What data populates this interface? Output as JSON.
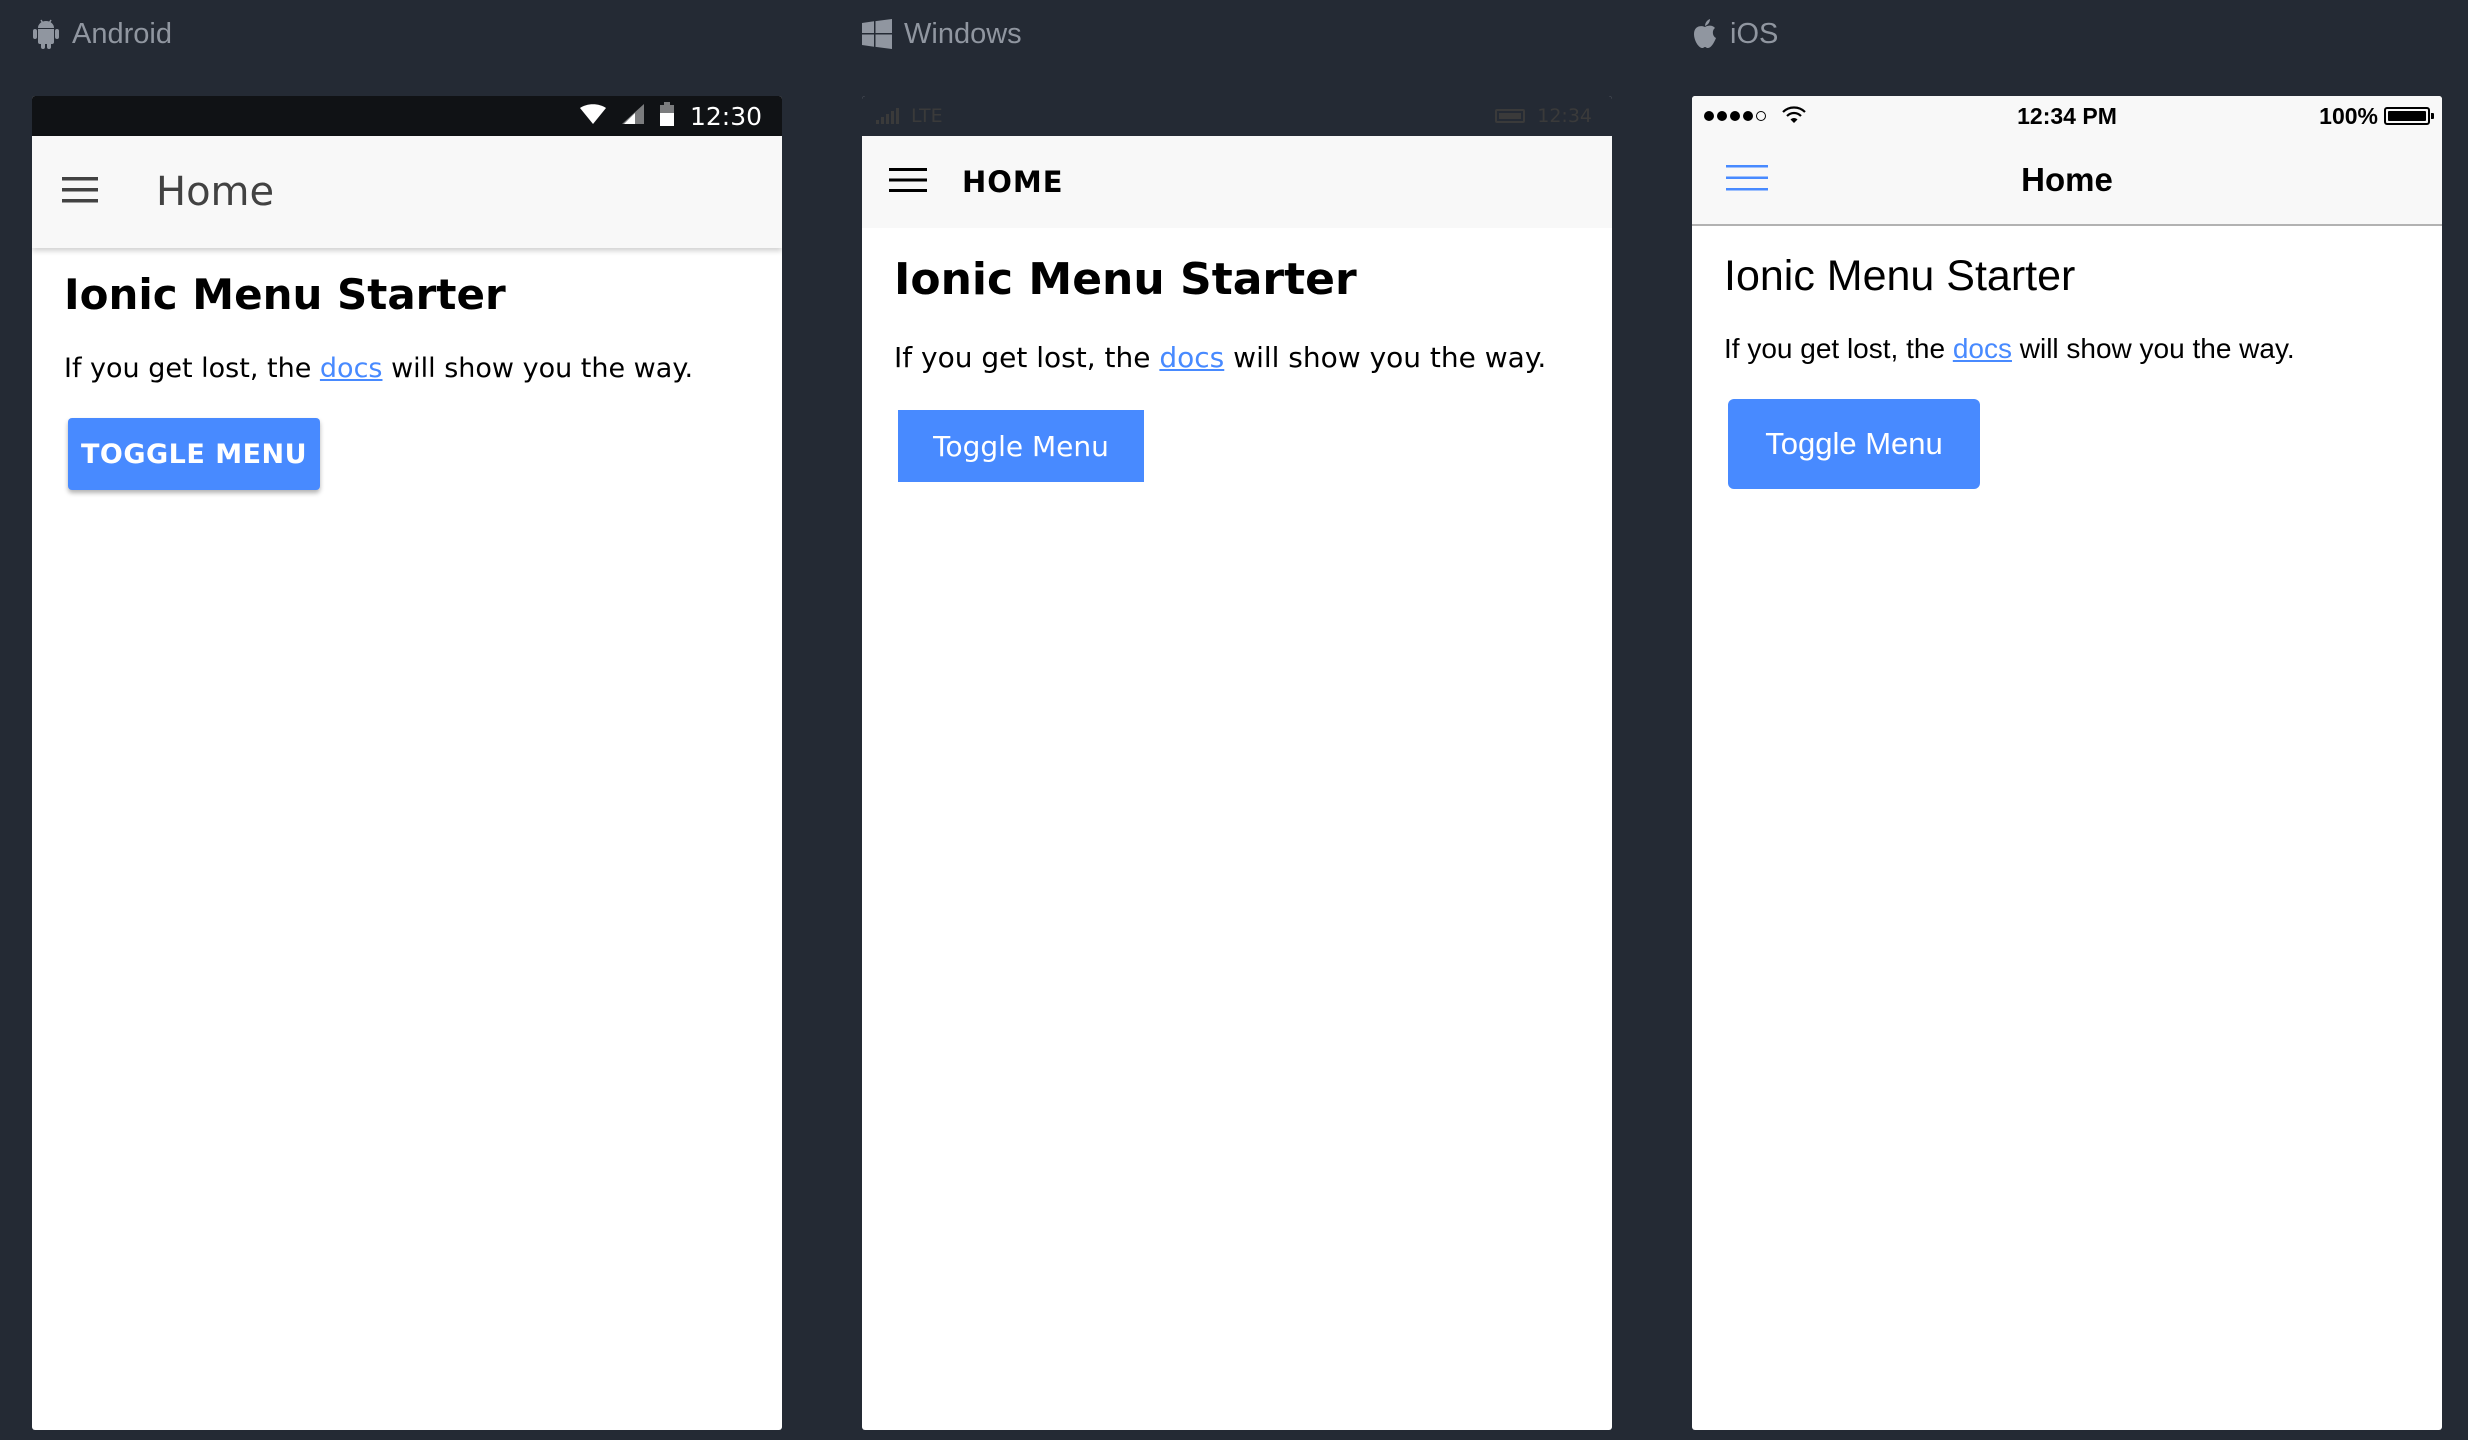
{
  "platforms": {
    "android": {
      "label": "Android",
      "icon": "android-icon",
      "status_bar": {
        "time": "12:30",
        "icons": [
          "wifi-icon",
          "cell-signal-icon",
          "battery-icon"
        ]
      },
      "toolbar": {
        "title": "Home",
        "menu_icon": "hamburger-menu-icon"
      },
      "content": {
        "heading": "Ionic Menu Starter",
        "text_before": "If you get lost, the ",
        "link_text": "docs",
        "text_after": " will show you the way.",
        "button_label": "TOGGLE MENU"
      }
    },
    "windows": {
      "label": "Windows",
      "icon": "windows-logo-icon",
      "status_bar": {
        "network": "LTE",
        "time": "12:34",
        "icons": [
          "cell-signal-icon",
          "battery-icon"
        ]
      },
      "toolbar": {
        "title": "HOME",
        "menu_icon": "hamburger-menu-icon"
      },
      "content": {
        "heading": "Ionic Menu Starter",
        "text_before": "If you get lost, the ",
        "link_text": "docs",
        "text_after": " will show you the way.",
        "button_label": "Toggle Menu"
      }
    },
    "ios": {
      "label": "iOS",
      "icon": "apple-logo-icon",
      "status_bar": {
        "time": "12:34 PM",
        "battery": "100%",
        "icons": [
          "signal-dots-icon",
          "wifi-icon",
          "battery-icon"
        ]
      },
      "toolbar": {
        "title": "Home",
        "menu_icon": "hamburger-menu-icon"
      },
      "content": {
        "heading": "Ionic Menu Starter",
        "text_before": "If you get lost, the ",
        "link_text": "docs",
        "text_after": " will show you the way.",
        "button_label": "Toggle Menu"
      }
    }
  },
  "colors": {
    "background": "#242a34",
    "primary": "#488aff",
    "toolbar": "#f8f8f8",
    "android_status_bar": "#101215",
    "platform_label": "#9096a0"
  }
}
